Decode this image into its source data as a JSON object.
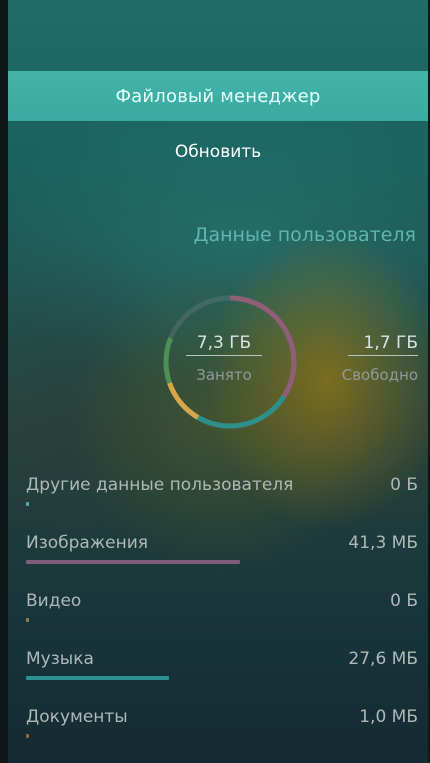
{
  "header": {
    "title": "Файловый менеджер"
  },
  "toolbar": {
    "refresh_label": "Обновить"
  },
  "storage": {
    "section_title": "Данные пользователя",
    "used_value": "7,3 ГБ",
    "used_label": "Занято",
    "free_value": "1,7 ГБ",
    "free_label": "Свободно",
    "used_fraction": 0.81,
    "ring_colors": [
      "#8f5f78",
      "#2f8f8a",
      "#d7a64a",
      "#4d8f55"
    ]
  },
  "categories": [
    {
      "name": "Другие данные пользователя",
      "size": "0 Б",
      "fraction": 0.007,
      "color": "#5ba9a8"
    },
    {
      "name": "Изображения",
      "size": "41,3 МБ",
      "fraction": 0.545,
      "color": "#7f5d7a"
    },
    {
      "name": "Видео",
      "size": "0 Б",
      "fraction": 0.007,
      "color": "#9b7c4a"
    },
    {
      "name": "Музыка",
      "size": "27,6 МБ",
      "fraction": 0.365,
      "color": "#2c8f91"
    },
    {
      "name": "Документы",
      "size": "1,0 МБ",
      "fraction": 0.007,
      "color": "#9b6a3f"
    }
  ],
  "colors": {
    "accent": "#3aaaa1",
    "section_title": "#5fb6b0"
  }
}
